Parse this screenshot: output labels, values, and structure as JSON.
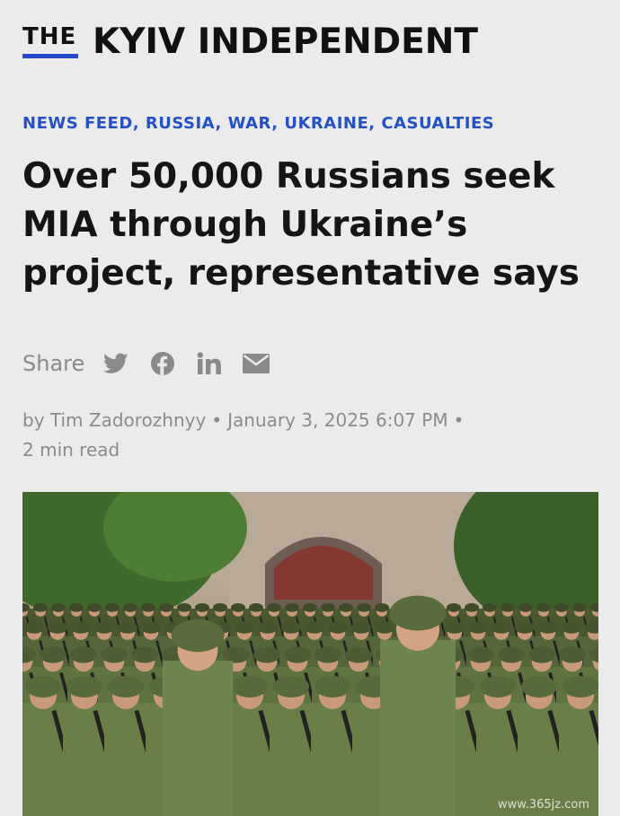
{
  "masthead": {
    "the": "THE",
    "name": "KYIV INDEPENDENT"
  },
  "tags": [
    "NEWS FEED",
    "RUSSIA",
    "WAR",
    "UKRAINE",
    "CASUALTIES"
  ],
  "headline": "Over 50,000 Russians seek MIA through Ukraine’s project, representative says",
  "share": {
    "label": "Share",
    "icons": [
      "twitter-icon",
      "facebook-icon",
      "linkedin-icon",
      "email-icon"
    ]
  },
  "byline": {
    "author": "by Tim Zadorozhnyy",
    "date": "January 3, 2025 6:07 PM",
    "separator": "•",
    "read_time": "2 min read"
  },
  "colors": {
    "accent": "#2451c7",
    "background": "#ebebeb",
    "muted": "#8a8a8a"
  }
}
